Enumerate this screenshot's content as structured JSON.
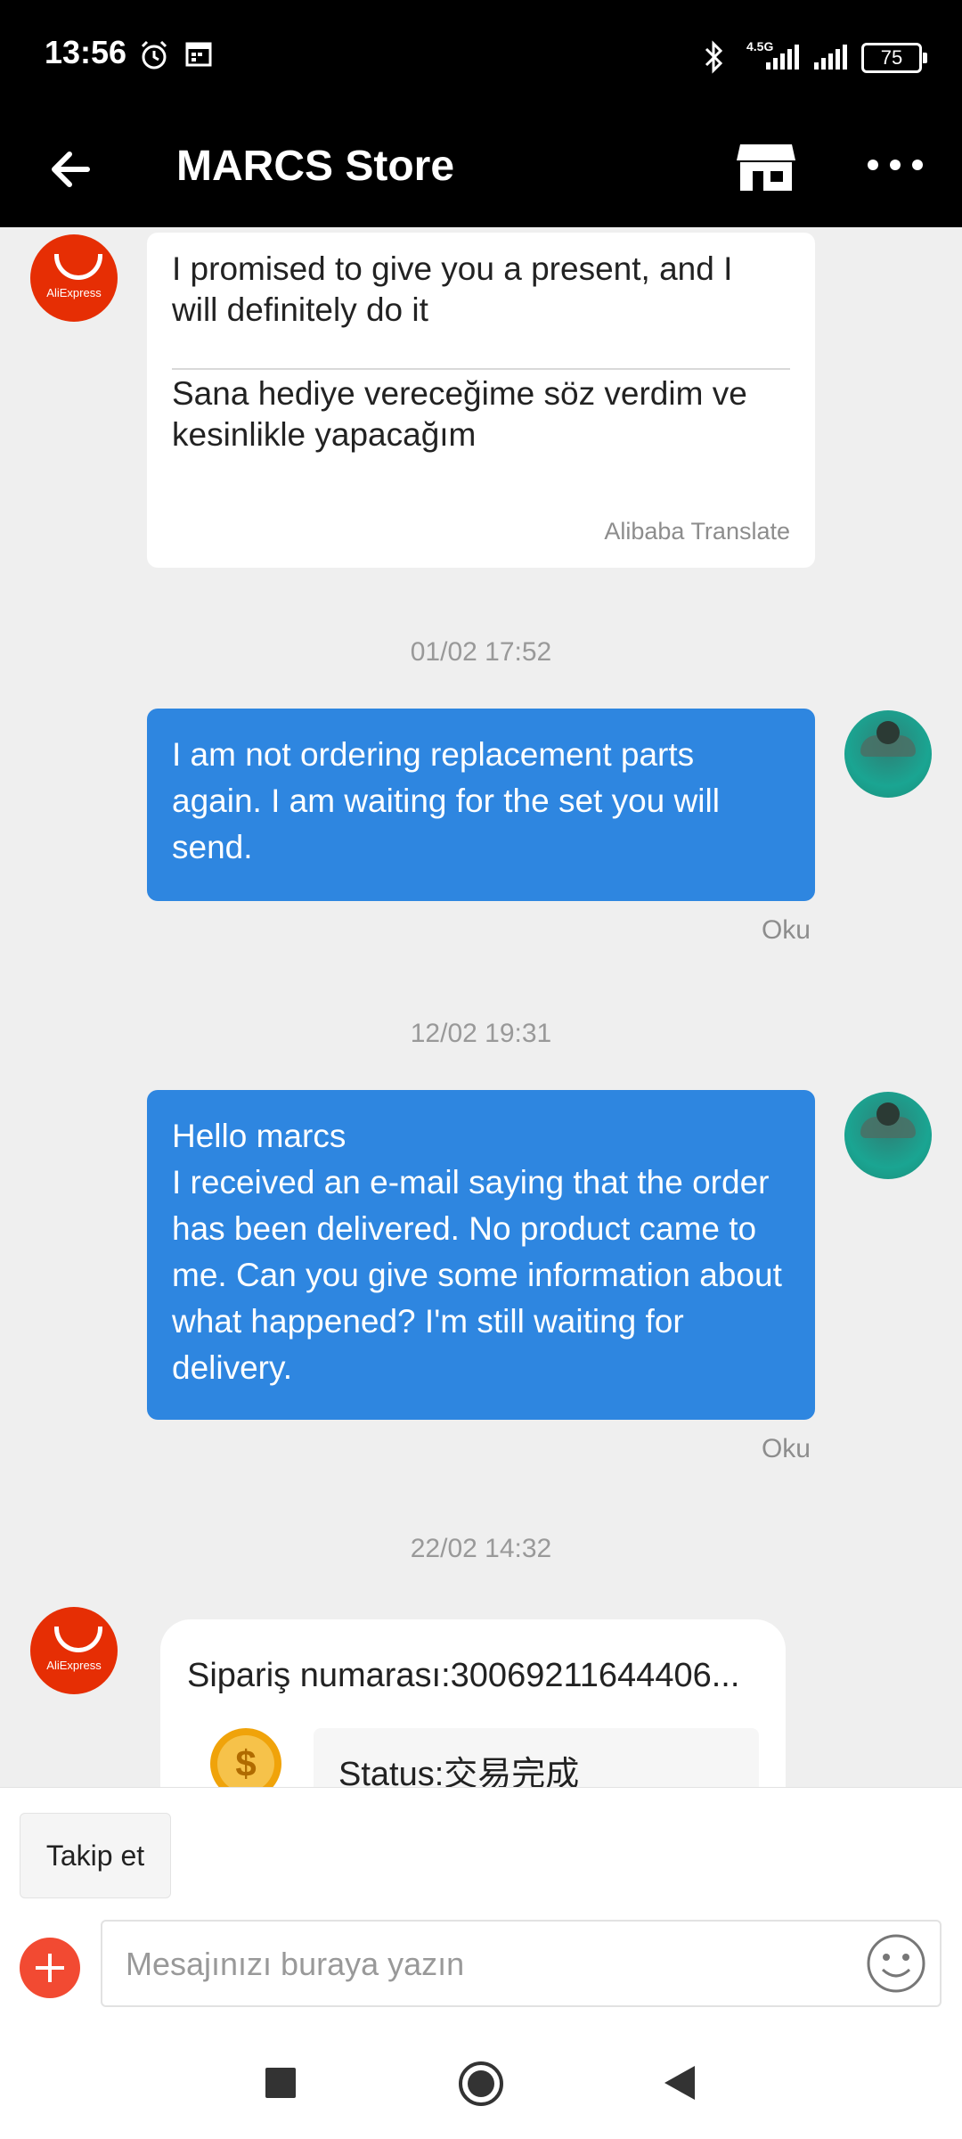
{
  "status_bar": {
    "time": "13:56",
    "network": "4.5G",
    "battery": "75"
  },
  "header": {
    "title": "MARCS Store"
  },
  "messages": {
    "m1": {
      "sender_label": "AliExpress",
      "original": "I promised to give you a present, and I will definitely do it",
      "translated": "Sana hediye vereceğime söz verdim ve kesinlikle yapacağım",
      "translator": "Alibaba Translate"
    },
    "ts1": "01/02 17:52",
    "m2": {
      "text": "I am not ordering replacement parts again. I am waiting for the set you will send.",
      "status": "Oku"
    },
    "ts2": "12/02 19:31",
    "m3": {
      "line1": "Hello marcs",
      "text": "I received an e-mail saying that the order has been delivered. No product came to me. Can you give some information about what happened? I'm still waiting for delivery.",
      "status": "Oku"
    },
    "ts3": "22/02 14:32",
    "m4": {
      "sender_label": "AliExpress",
      "order_title": "Sipariş numarası:30069211644406...",
      "status": "Status:交易完成"
    }
  },
  "bottom": {
    "follow_label": "Takip et",
    "input_placeholder": "Mesajınızı buraya yazın"
  },
  "colors": {
    "header_bg": "#000000",
    "bubble_blue": "#2e86e0",
    "aliexpress_red": "#e62e04",
    "plus_red": "#f24a32"
  }
}
